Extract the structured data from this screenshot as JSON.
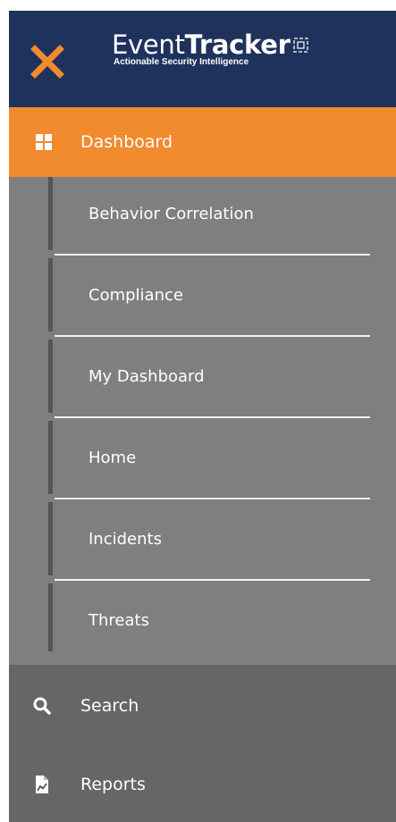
{
  "app": {
    "logo_event": "Event",
    "logo_tracker": "Tracker",
    "tagline": "Actionable Security Intelligence"
  },
  "nav": {
    "dashboard": {
      "label": "Dashboard",
      "icon": "grid-icon",
      "active": true
    },
    "dashboard_items": [
      {
        "label": "Behavior Correlation"
      },
      {
        "label": "Compliance"
      },
      {
        "label": "My Dashboard"
      },
      {
        "label": "Home"
      },
      {
        "label": "Incidents"
      },
      {
        "label": "Threats"
      }
    ],
    "search": {
      "label": "Search",
      "icon": "search-icon"
    },
    "reports": {
      "label": "Reports",
      "icon": "report-icon"
    }
  },
  "colors": {
    "header_bg": "#1f325c",
    "accent": "#f28a2e",
    "submenu_bg": "#7f7f7f",
    "menu_bg": "#666666"
  }
}
